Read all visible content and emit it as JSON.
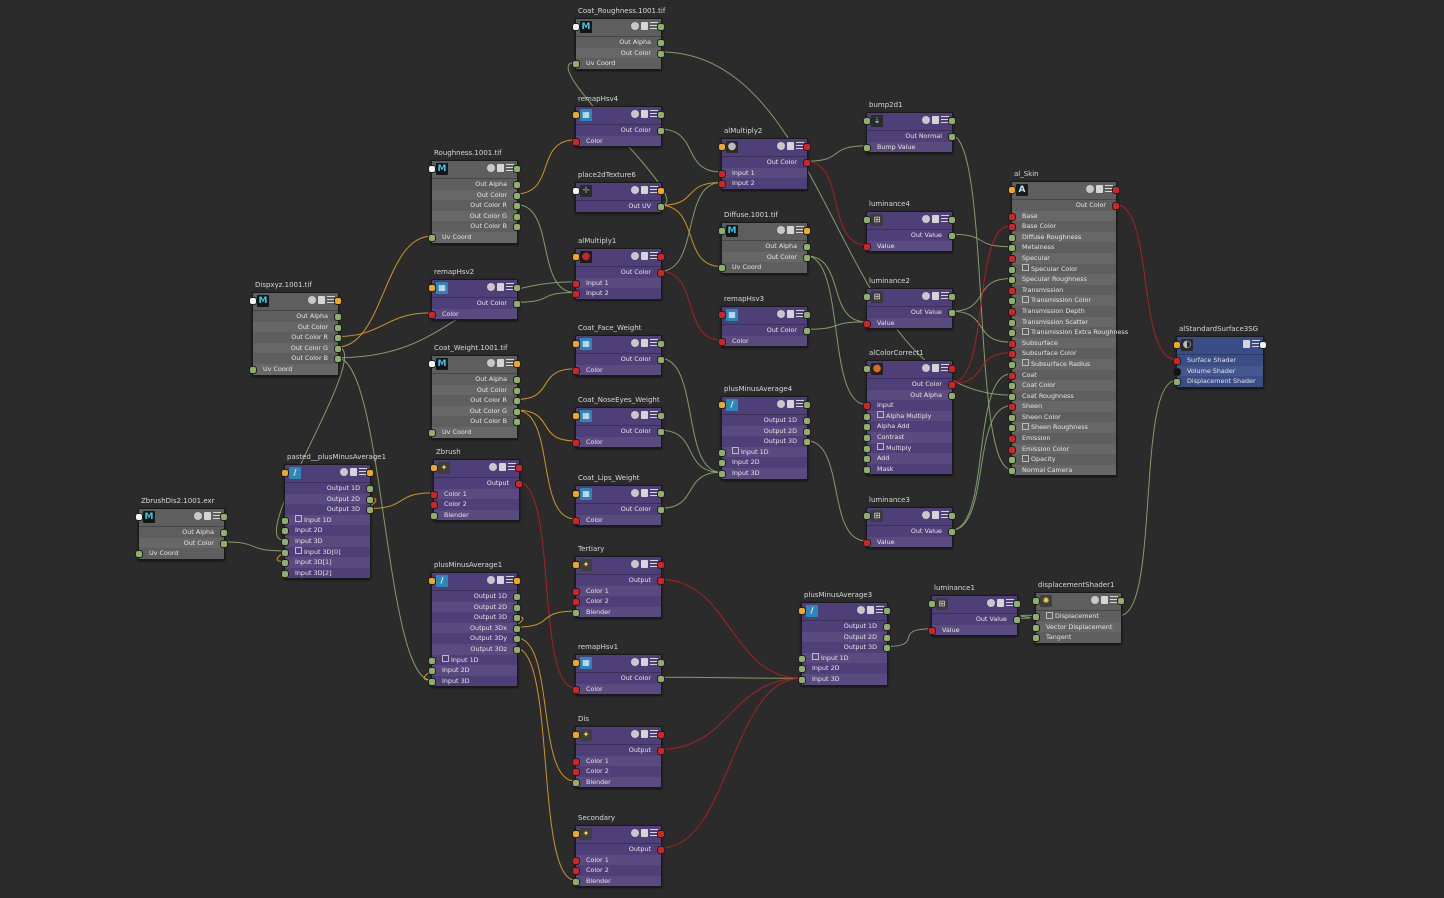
{
  "canvas": {
    "background": "#2b2b2b"
  },
  "colors": {
    "wire_green": "#8ca870",
    "wire_red": "#b82020",
    "wire_orange": "#e0a020",
    "node_gray": "#5e5e5e",
    "node_purple": "#4f3f78",
    "node_blue": "#3a4d86"
  },
  "nodes": {
    "coat_rough": {
      "title": "Coat_Roughness.1001.tif",
      "icon": "M",
      "attrs": [
        "Out Alpha",
        "Out Color",
        "Uv Coord"
      ]
    },
    "remaphsv4": {
      "title": "remapHsv4",
      "attrs": [
        "Out Color",
        "Color"
      ]
    },
    "roughness": {
      "title": "Roughness.1001.tif",
      "icon": "M",
      "attrs": [
        "Out Alpha",
        "Out Color",
        "Out Color R",
        "Out Color G",
        "Out Color B",
        "Uv Coord"
      ]
    },
    "place2d": {
      "title": "place2dTexture6",
      "attrs": [
        "Out UV"
      ]
    },
    "almult2": {
      "title": "alMultiply2",
      "attrs": [
        "Out Color",
        "Input 1",
        "Input 2"
      ]
    },
    "bump2d1": {
      "title": "bump2d1",
      "attrs": [
        "Out Normal",
        "Bump Value"
      ]
    },
    "almult1": {
      "title": "alMultiply1",
      "attrs": [
        "Out Color",
        "Input 1",
        "Input 2"
      ]
    },
    "diffuse": {
      "title": "Diffuse.1001.tif",
      "icon": "M",
      "attrs": [
        "Out Alpha",
        "Out Color",
        "Uv Coord"
      ]
    },
    "lum4": {
      "title": "luminance4",
      "attrs": [
        "Out Value",
        "Value"
      ]
    },
    "alskin": {
      "title": "al_Skin",
      "icon": "A",
      "attrs": [
        "Out Color",
        "Base",
        "Base Color",
        "Diffuse Roughness",
        "Metalness",
        "Specular",
        "Specular Color",
        "Specular Roughness",
        "Transmission",
        "Transmission Color",
        "Transmission Depth",
        "Transmission Scatter",
        "Transmission Extra Roughness",
        "Subsurface",
        "Subsurface Color",
        "Subsurface Radius",
        "Coat",
        "Coat Color",
        "Coat Roughness",
        "Sheen",
        "Sheen Color",
        "Sheen Roughness",
        "Emission",
        "Emission Color",
        "Opacity",
        "Normal Camera"
      ]
    },
    "dispxyz": {
      "title": "Dispxyz.1001.tif",
      "icon": "M",
      "attrs": [
        "Out Alpha",
        "Out Color",
        "Out Color R",
        "Out Color G",
        "Out Color B",
        "Uv Coord"
      ]
    },
    "remaphsv2": {
      "title": "remapHsv2",
      "attrs": [
        "Out Color",
        "Color"
      ]
    },
    "remaphsv3": {
      "title": "remapHsv3",
      "attrs": [
        "Out Color",
        "Color"
      ]
    },
    "lum2": {
      "title": "luminance2",
      "attrs": [
        "Out Value",
        "Value"
      ]
    },
    "coat_weight": {
      "title": "Coat_Weight.1001.tif",
      "icon": "M",
      "attrs": [
        "Out Alpha",
        "Out Color",
        "Out Color R",
        "Out Color G",
        "Out Color B",
        "Uv Coord"
      ]
    },
    "coat_face": {
      "title": "Coat_Face_Weight",
      "attrs": [
        "Out Color",
        "Color"
      ]
    },
    "alsg": {
      "title": "alStandardSurface3SG",
      "attrs": [
        "Surface Shader",
        "Volume Shader",
        "Displacement Shader"
      ]
    },
    "alcc": {
      "title": "alColorCorrect1",
      "attrs": [
        "Out Color",
        "Out Alpha",
        "Input",
        "Alpha Multiply",
        "Alpha Add",
        "Contrast",
        "Multiply",
        "Add",
        "Mask"
      ]
    },
    "pma4": {
      "title": "plusMinusAverage4",
      "attrs": [
        "Output 1D",
        "Output 2D",
        "Output 3D",
        "Input 1D",
        "Input 2D",
        "Input 3D"
      ]
    },
    "coat_nose": {
      "title": "Coat_NoseEyes_Weight",
      "attrs": [
        "Out Color",
        "Color"
      ]
    },
    "pasted_pma": {
      "title": "pasted__plusMinusAverage1",
      "attrs": [
        "Output 1D",
        "Output 2D",
        "Output 3D",
        "Input 1D",
        "Input 2D",
        "Input 3D",
        "Input 3D[0]",
        "Input 3D[1]",
        "Input 3D[2]"
      ]
    },
    "zbrush": {
      "title": "Zbrush",
      "attrs": [
        "Output",
        "Color 1",
        "Color 2",
        "Blender"
      ]
    },
    "coat_lips": {
      "title": "Coat_Lips_Weight",
      "attrs": [
        "Out Color",
        "Color"
      ]
    },
    "lum3": {
      "title": "luminance3",
      "attrs": [
        "Out Value",
        "Value"
      ]
    },
    "zbrushdis": {
      "title": "ZbrushDis2.1001.exr",
      "icon": "M",
      "attrs": [
        "Out Alpha",
        "Out Color",
        "Uv Coord"
      ]
    },
    "tertiary": {
      "title": "Tertiary",
      "attrs": [
        "Output",
        "Color 1",
        "Color 2",
        "Blender"
      ]
    },
    "pma1": {
      "title": "plusMinusAverage1",
      "attrs": [
        "Output 1D",
        "Output 2D",
        "Output 3D",
        "Output 3Dx",
        "Output 3Dy",
        "Output 3Dz",
        "Input 1D",
        "Input 2D",
        "Input 3D"
      ]
    },
    "lum1": {
      "title": "luminance1",
      "attrs": [
        "Out Value",
        "Value"
      ]
    },
    "dispshader": {
      "title": "displacementShader1",
      "attrs": [
        "Displacement",
        "Vector Displacement",
        "Tangent"
      ]
    },
    "pma3": {
      "title": "plusMinusAverage3",
      "attrs": [
        "Output 1D",
        "Output 2D",
        "Output 3D",
        "Input 1D",
        "Input 2D",
        "Input 3D"
      ]
    },
    "remaphsv1": {
      "title": "remapHsv1",
      "attrs": [
        "Out Color",
        "Color"
      ]
    },
    "dis": {
      "title": "Dis",
      "attrs": [
        "Output",
        "Color 1",
        "Color 2",
        "Blender"
      ]
    },
    "secondary": {
      "title": "Secondary",
      "attrs": [
        "Output",
        "Color 1",
        "Color 2",
        "Blender"
      ]
    }
  }
}
